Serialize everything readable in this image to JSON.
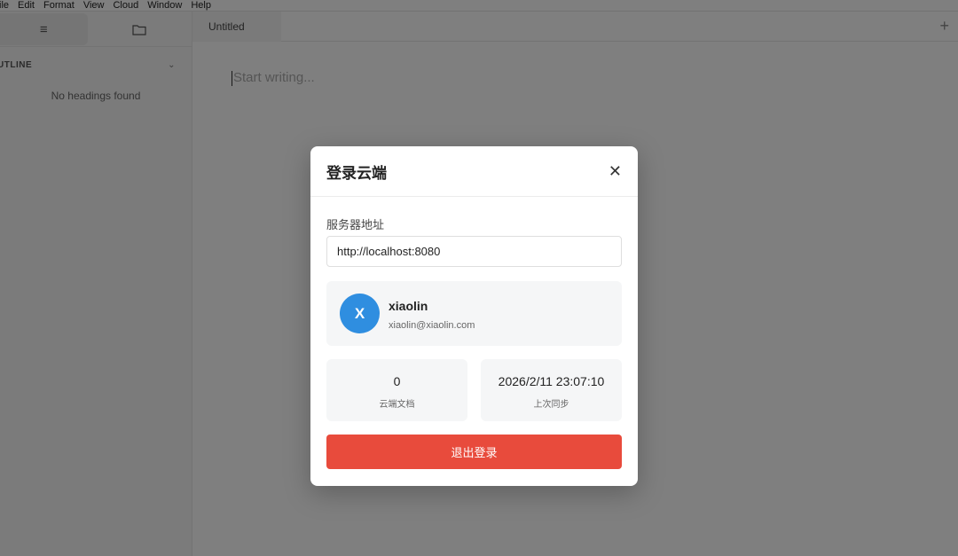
{
  "menubar": {
    "items": [
      "ile",
      "Edit",
      "Format",
      "View",
      "Cloud",
      "Window",
      "Help"
    ]
  },
  "sidebar": {
    "tabs": [
      {
        "icon": "list-icon",
        "glyph": "≡"
      },
      {
        "icon": "folder-icon"
      }
    ],
    "outline_label": "UTLINE",
    "outline_chevron": "⌄",
    "empty_text": "No headings found"
  },
  "editor": {
    "tab_title": "Untitled",
    "add_tab": "+",
    "placeholder": "Start writing..."
  },
  "modal": {
    "title": "登录云端",
    "close": "✕",
    "server_label": "服务器地址",
    "server_value": "http://localhost:8080",
    "user": {
      "initial": "X",
      "name": "xiaolin",
      "email": "xiaolin@xiaolin.com"
    },
    "stats": [
      {
        "value": "0",
        "label": "云端文档"
      },
      {
        "value": "2026/2/11 23:07:10",
        "label": "上次同步"
      }
    ],
    "logout_label": "退出登录",
    "colors": {
      "avatar": "#2f8ee0",
      "logout": "#e84b3c"
    }
  }
}
